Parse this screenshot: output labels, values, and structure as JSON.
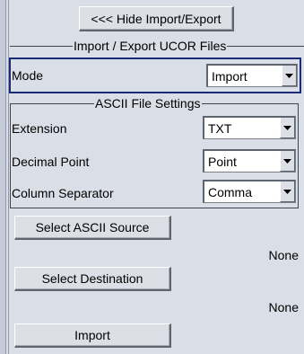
{
  "hide_button_label": "<<< Hide Import/Export",
  "import_export_group": {
    "title": "Import / Export UCOR Files",
    "mode": {
      "label": "Mode",
      "value": "Import"
    }
  },
  "ascii_group": {
    "title": "ASCII File Settings",
    "rows": [
      {
        "label": "Extension",
        "value": "TXT"
      },
      {
        "label": "Decimal Point",
        "value": "Point"
      },
      {
        "label": "Column Separator",
        "value": "Comma"
      }
    ]
  },
  "select_source": {
    "label": "Select ASCII Source",
    "value": "None"
  },
  "select_destination": {
    "label": "Select Destination",
    "value": "None"
  },
  "import_button_label": "Import",
  "colors": {
    "panel": "#dadee6",
    "mode_frame": "#1c2a7a"
  },
  "icons": {
    "combo_arrow": "triangle-down-icon"
  }
}
